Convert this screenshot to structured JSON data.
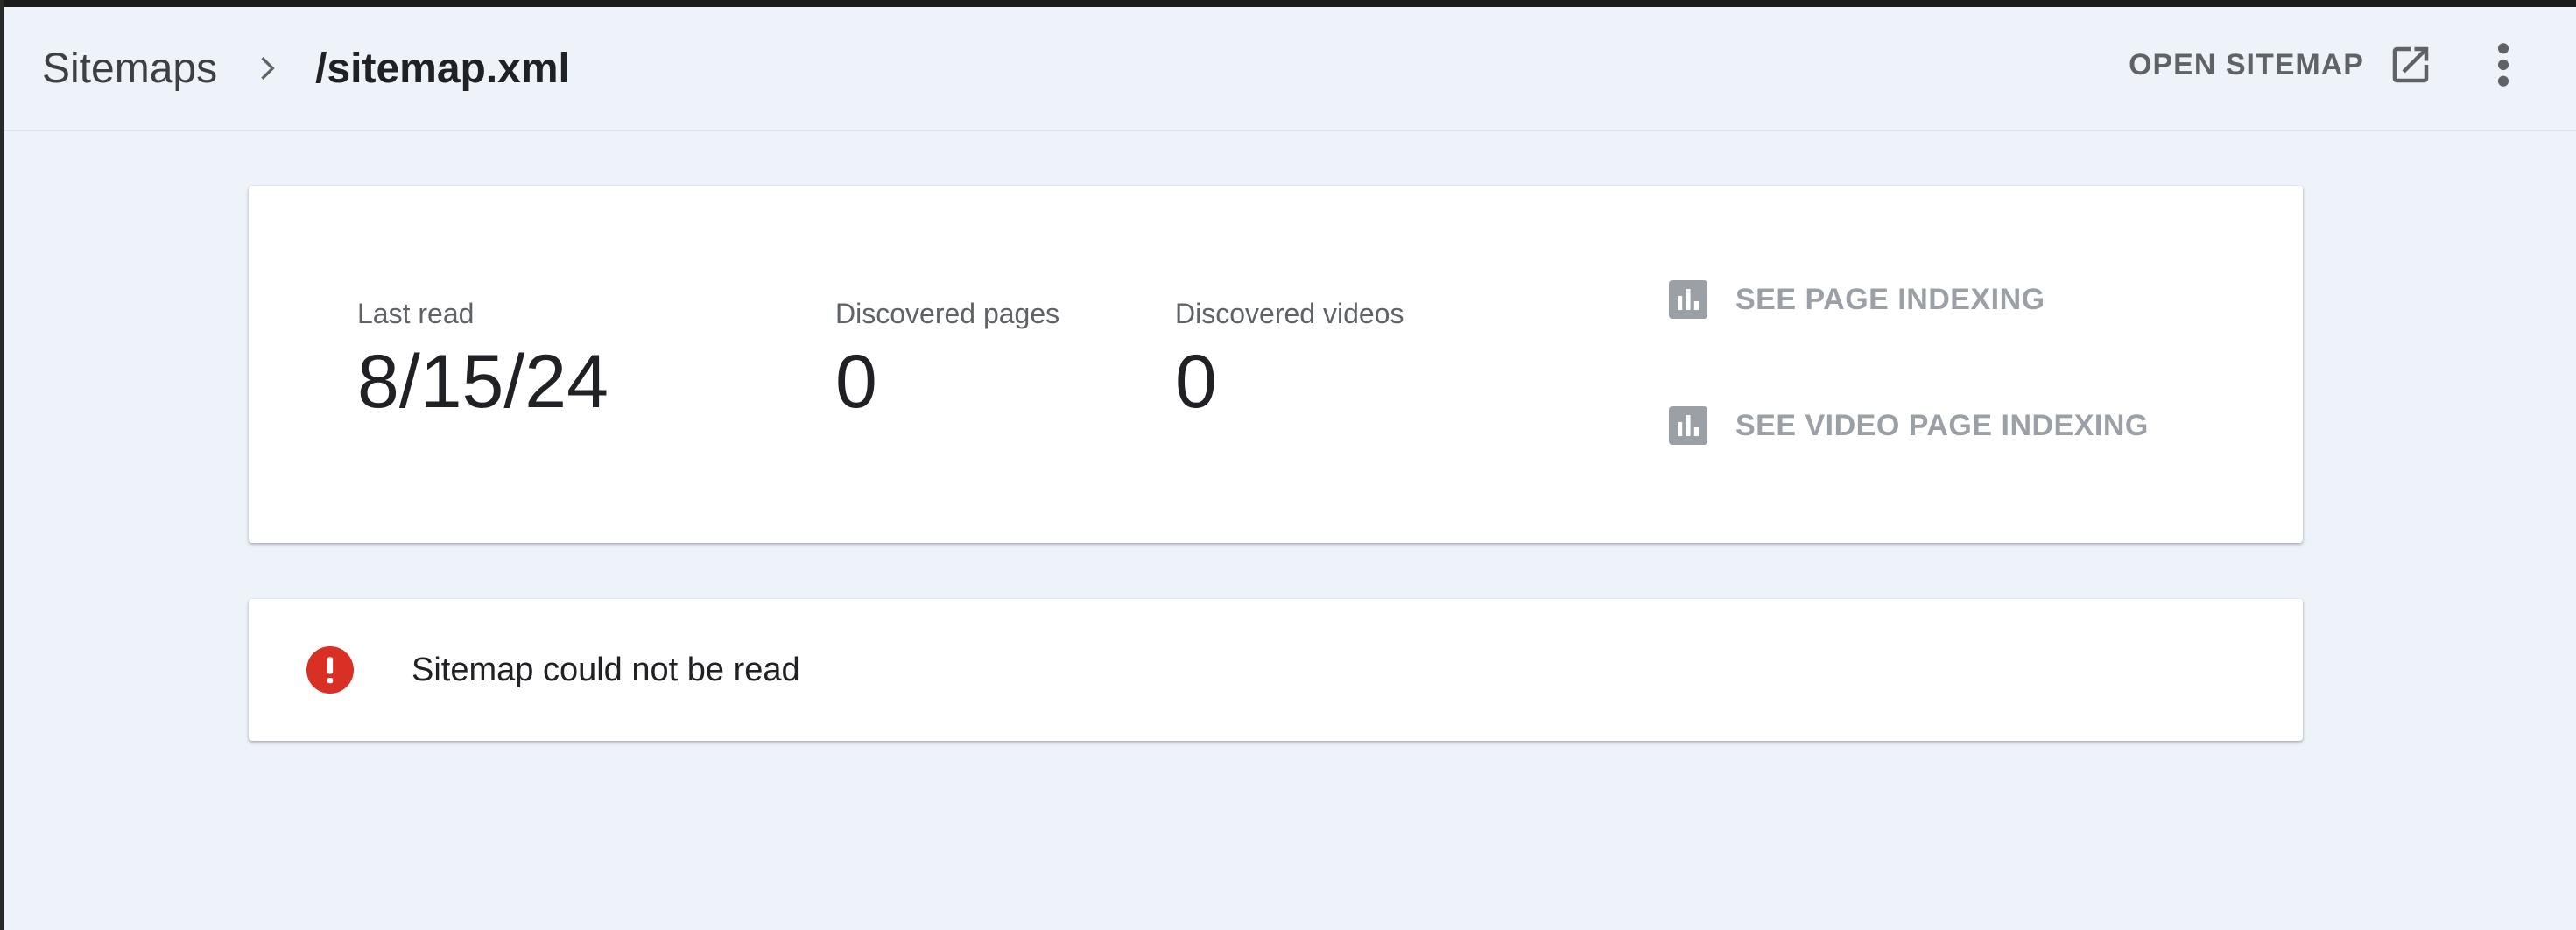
{
  "breadcrumb": {
    "root": "Sitemaps",
    "current": "/sitemap.xml"
  },
  "header": {
    "open_sitemap_label": "OPEN SITEMAP"
  },
  "stats": {
    "last_read_label": "Last read",
    "last_read_value": "8/15/24",
    "pages_label": "Discovered pages",
    "pages_value": "0",
    "videos_label": "Discovered videos",
    "videos_value": "0"
  },
  "links": {
    "page_indexing": "SEE PAGE INDEXING",
    "video_indexing": "SEE VIDEO PAGE INDEXING"
  },
  "error": {
    "message": "Sitemap could not be read"
  },
  "icons": {
    "chevron": "chevron-right-icon",
    "external": "open-in-new-icon",
    "more": "more-vert-icon",
    "bar_chart": "bar-chart-icon",
    "error": "error-icon"
  },
  "colors": {
    "background": "#eef2f9",
    "error_red": "#d93025",
    "link_gray": "#9aa0a6",
    "text_dark": "#202124"
  }
}
